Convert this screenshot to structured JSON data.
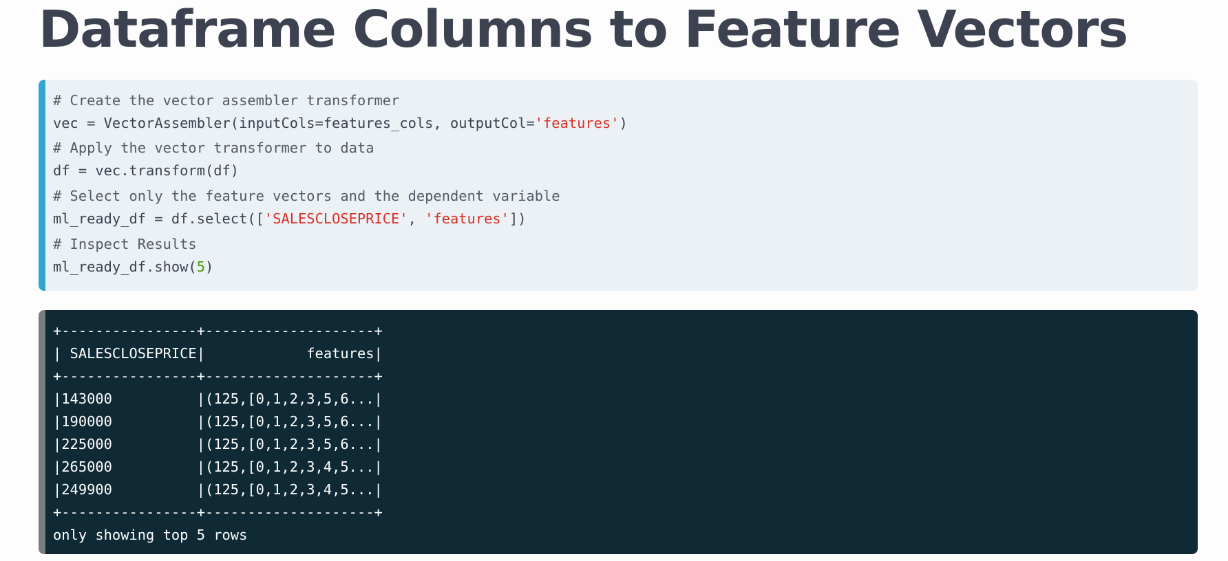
{
  "title": "Dataframe Columns to Feature Vectors",
  "code": {
    "comment_1": "# Create the vector assembler transformer",
    "line_1a": "vec = VectorAssembler(inputCols=features_cols, outputCol=",
    "line_1b": "'features'",
    "line_1c": ")",
    "comment_2": "# Apply the vector transformer to data",
    "line_2": "df = vec.transform(df)",
    "comment_3": "# Select only the feature vectors and the dependent variable",
    "line_3a": "ml_ready_df = df.select([",
    "line_3b": "'SALESCLOSEPRICE'",
    "line_3c": ", ",
    "line_3d": "'features'",
    "line_3e": "])",
    "comment_4": "# Inspect Results",
    "line_4a": "ml_ready_df.show(",
    "line_4b": "5",
    "line_4c": ")"
  },
  "output": {
    "lines": [
      "+----------------+--------------------+",
      "| SALESCLOSEPRICE|            features|",
      "+----------------+--------------------+",
      "|143000          |(125,[0,1,2,3,5,6...|",
      "|190000          |(125,[0,1,2,3,5,6...|",
      "|225000          |(125,[0,1,2,3,5,6...|",
      "|265000          |(125,[0,1,2,3,4,5...|",
      "|249900          |(125,[0,1,2,3,4,5...|",
      "+----------------+--------------------+",
      "only showing top 5 rows"
    ]
  },
  "colors": {
    "title": "#3d4251",
    "code_background": "#ebf1f5",
    "code_accent": "#33a5d0",
    "string": "#d93025",
    "number": "#4e9a06",
    "output_background": "#0f2935",
    "output_accent": "#787d82",
    "output_text": "#ffffff"
  }
}
